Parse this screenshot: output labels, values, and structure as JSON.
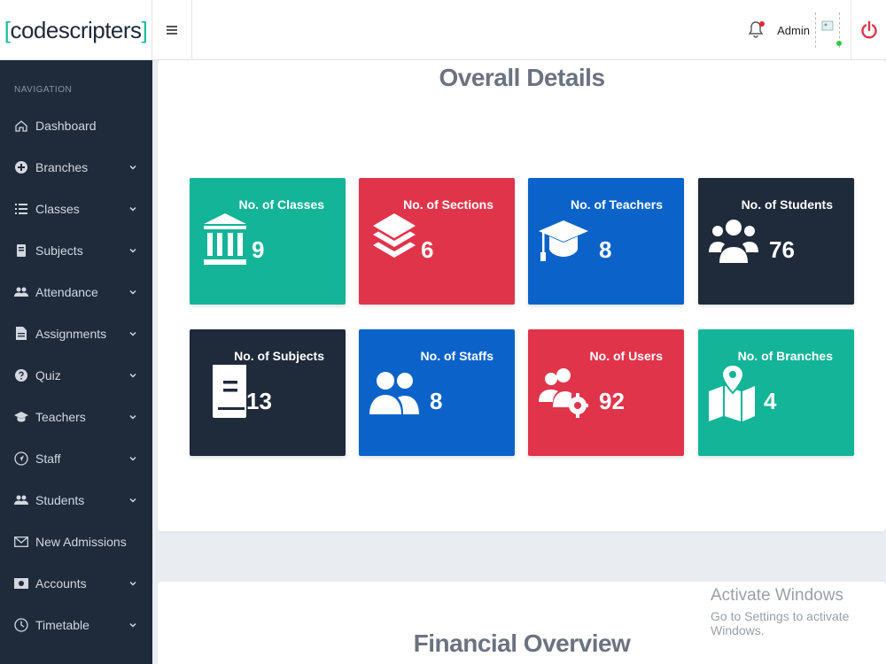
{
  "brand": {
    "name": "codescripters",
    "open": "[",
    "close": "]"
  },
  "topbar": {
    "menu_icon": "hamburger-icon",
    "user_name": "Admin",
    "bell_icon": "bell-icon",
    "power_icon": "power-icon"
  },
  "sidebar": {
    "heading": "NAVIGATION",
    "items": [
      {
        "label": "Dashboard",
        "icon": "home-icon",
        "chevron": false
      },
      {
        "label": "Branches",
        "icon": "plus-circle-icon",
        "chevron": true
      },
      {
        "label": "Classes",
        "icon": "list-icon",
        "chevron": true
      },
      {
        "label": "Subjects",
        "icon": "book-icon",
        "chevron": true
      },
      {
        "label": "Attendance",
        "icon": "users-icon",
        "chevron": true
      },
      {
        "label": "Assignments",
        "icon": "file-icon",
        "chevron": true
      },
      {
        "label": "Quiz",
        "icon": "question-icon",
        "chevron": true
      },
      {
        "label": "Teachers",
        "icon": "graduation-cap-icon",
        "chevron": true
      },
      {
        "label": "Staff",
        "icon": "navigation-icon",
        "chevron": true
      },
      {
        "label": "Students",
        "icon": "users-icon",
        "chevron": true
      },
      {
        "label": "New Admissions",
        "icon": "envelope-icon",
        "chevron": false
      },
      {
        "label": "Accounts",
        "icon": "money-icon",
        "chevron": true
      },
      {
        "label": "Timetable",
        "icon": "clock-icon",
        "chevron": true
      }
    ]
  },
  "overall": {
    "title": "Overall Details",
    "tiles": [
      {
        "label": "No. of Classes",
        "value": "9",
        "color": "#13b497",
        "icon": "institution-icon"
      },
      {
        "label": "No. of Sections",
        "value": "6",
        "color": "#e0344a",
        "icon": "layers-icon"
      },
      {
        "label": "No. of Teachers",
        "value": "8",
        "color": "#0b63c9",
        "icon": "graduation-cap-icon"
      },
      {
        "label": "No. of Students",
        "value": "76",
        "color": "#1f2a3b",
        "icon": "users-group-icon"
      },
      {
        "label": "No. of Subjects",
        "value": "13",
        "color": "#1f2a3b",
        "icon": "book-icon"
      },
      {
        "label": "No. of Staffs",
        "value": "8",
        "color": "#0b63c9",
        "icon": "users-icon"
      },
      {
        "label": "No. of Users",
        "value": "92",
        "color": "#e0344a",
        "icon": "users-cog-icon"
      },
      {
        "label": "No. of Branches",
        "value": "4",
        "color": "#13b497",
        "icon": "map-marker-icon"
      }
    ]
  },
  "financial": {
    "title": "Financial Overview"
  },
  "watermark": {
    "title": "Activate Windows",
    "subtitle": "Go to Settings to activate Windows."
  }
}
